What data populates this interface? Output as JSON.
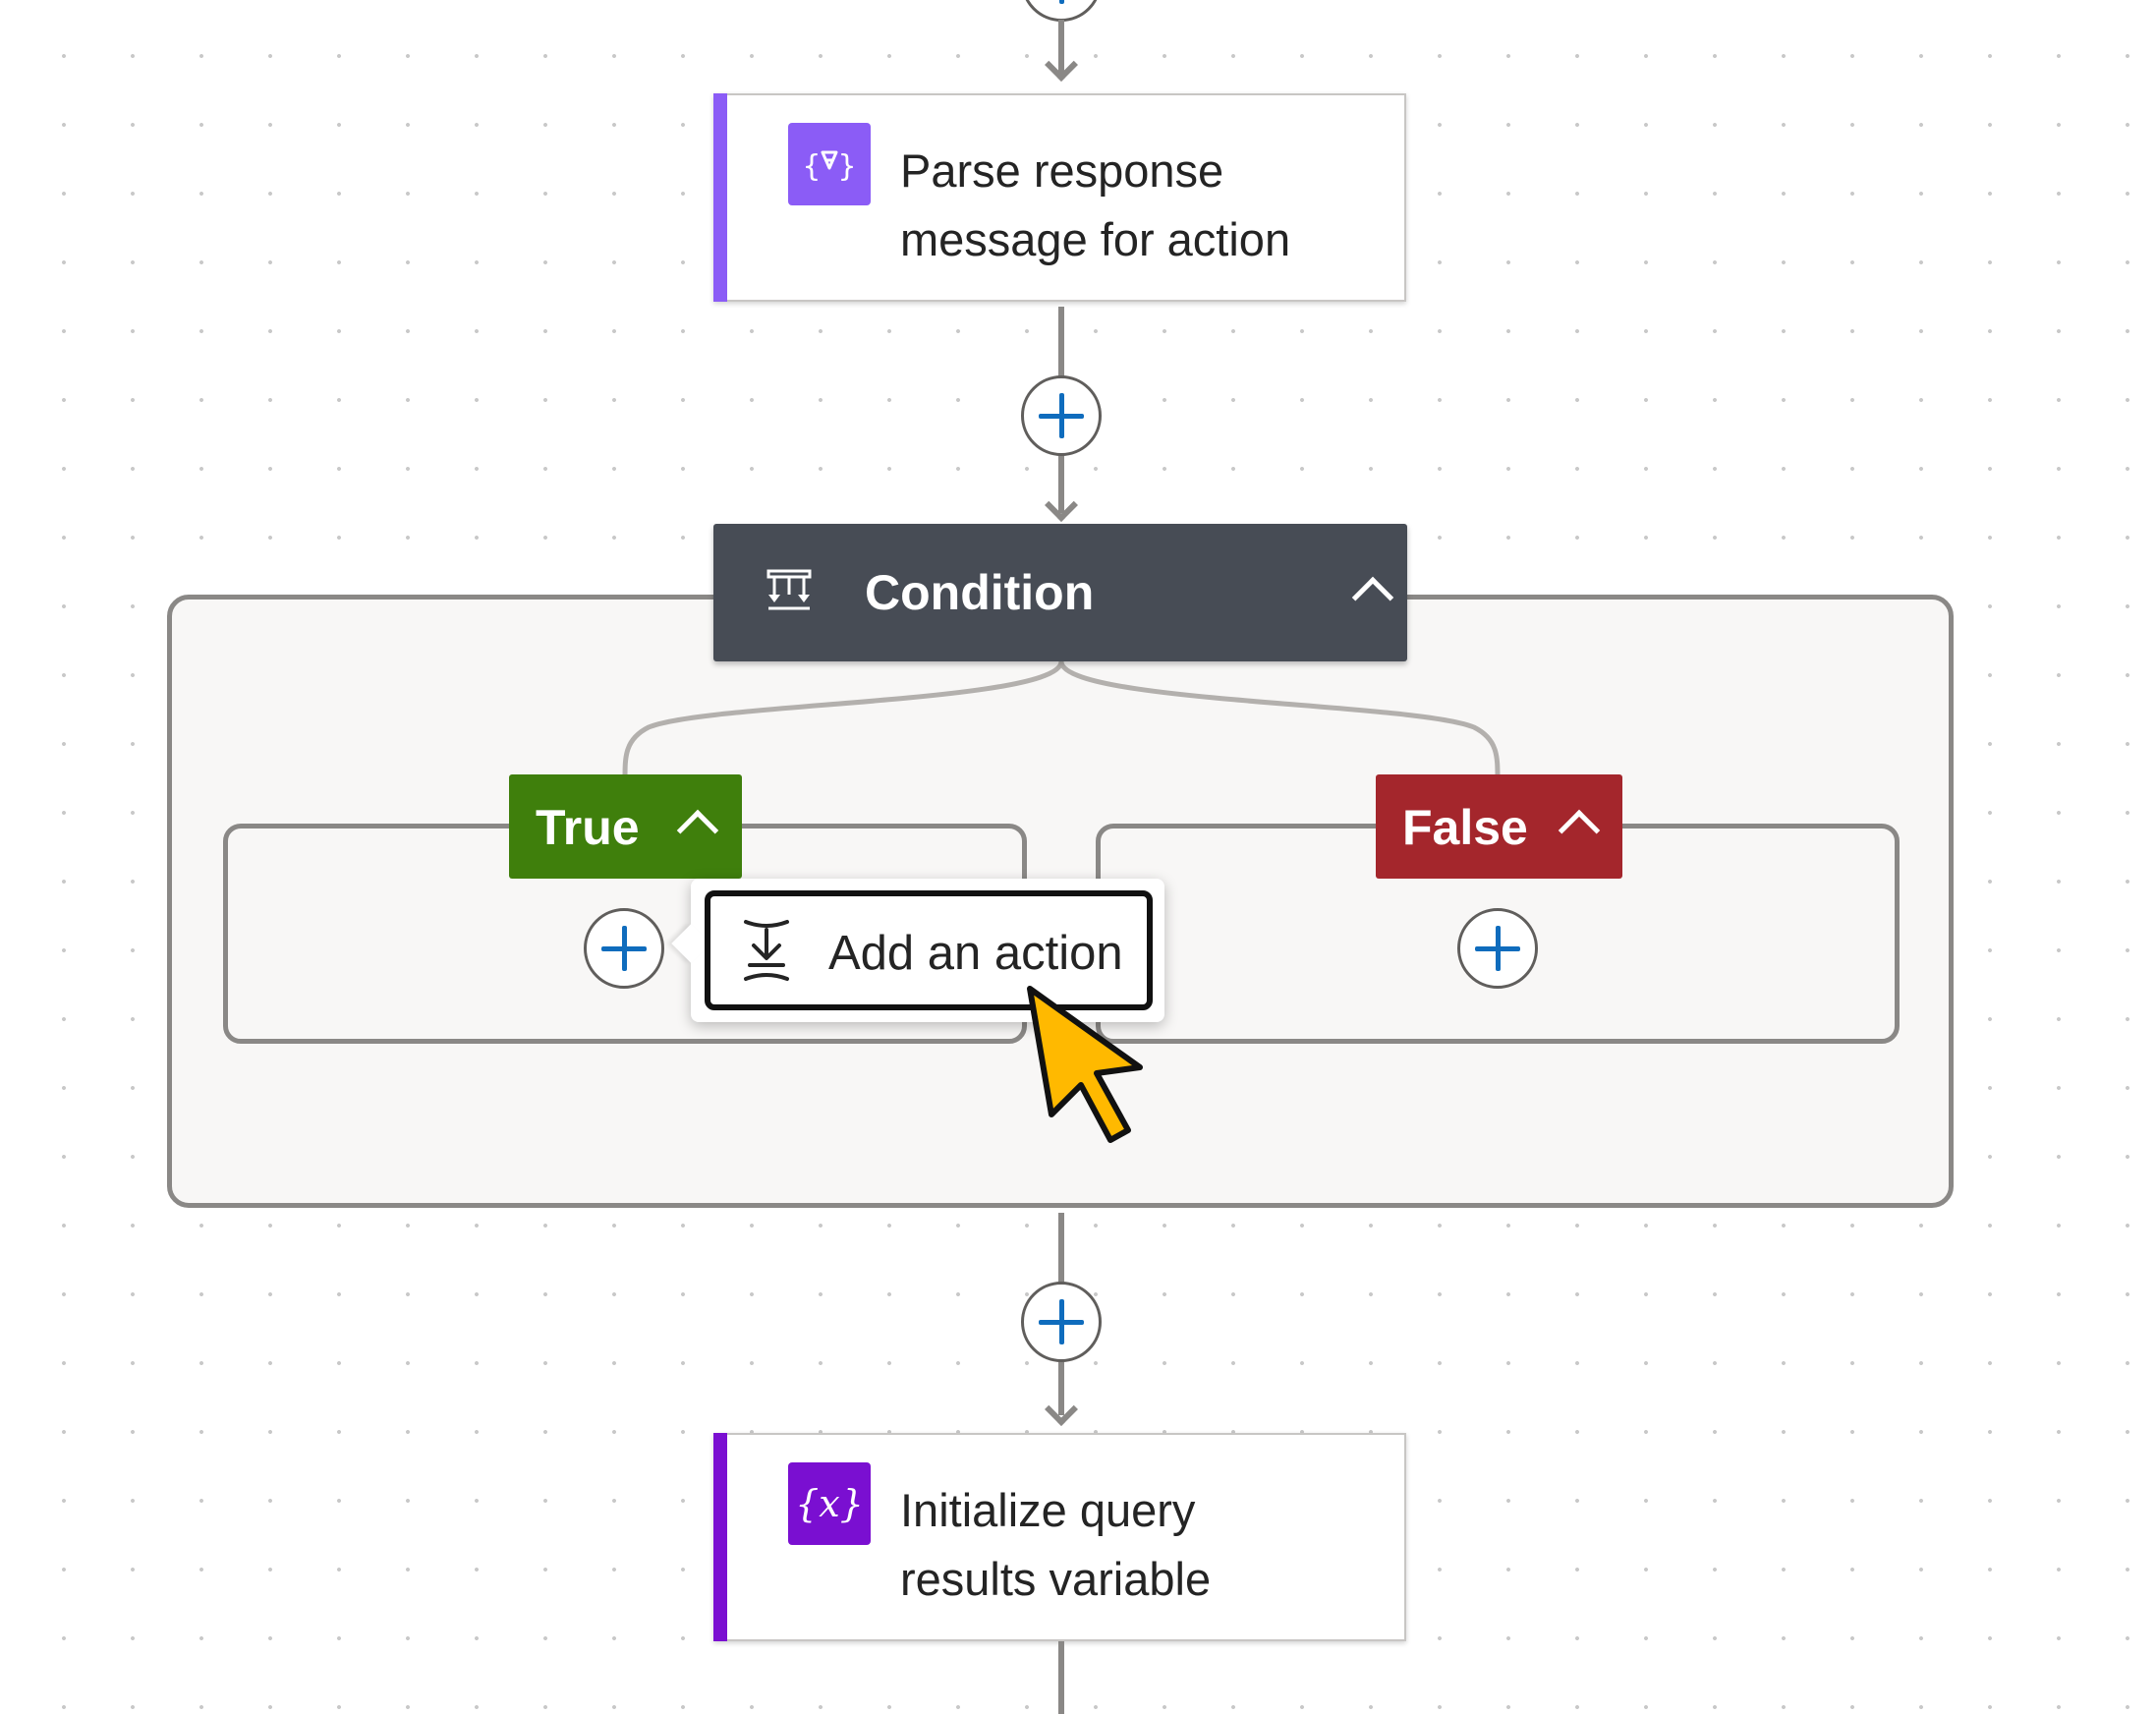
{
  "flow": {
    "parse_card": {
      "title_line1": "Parse response",
      "title_line2": "message for action",
      "icon": "parse-json-icon",
      "accent_color": "#8b5cf6"
    },
    "condition": {
      "title": "Condition",
      "icon": "condition-icon",
      "header_color": "#474c55",
      "true_branch": {
        "label": "True",
        "color": "#3f7f0c"
      },
      "false_branch": {
        "label": "False",
        "color": "#a4262c"
      }
    },
    "tooltip": {
      "label": "Add an action",
      "icon": "add-action-icon"
    },
    "init_card": {
      "title_line1": "Initialize query",
      "title_line2": "results variable",
      "icon": "variable-icon",
      "accent_color": "#7a0fd1"
    }
  },
  "icons": {
    "parse_glyph": "{∀}",
    "variable_glyph": "{𝑥}",
    "plus": "+",
    "cursor": "pointer-cursor-icon"
  }
}
